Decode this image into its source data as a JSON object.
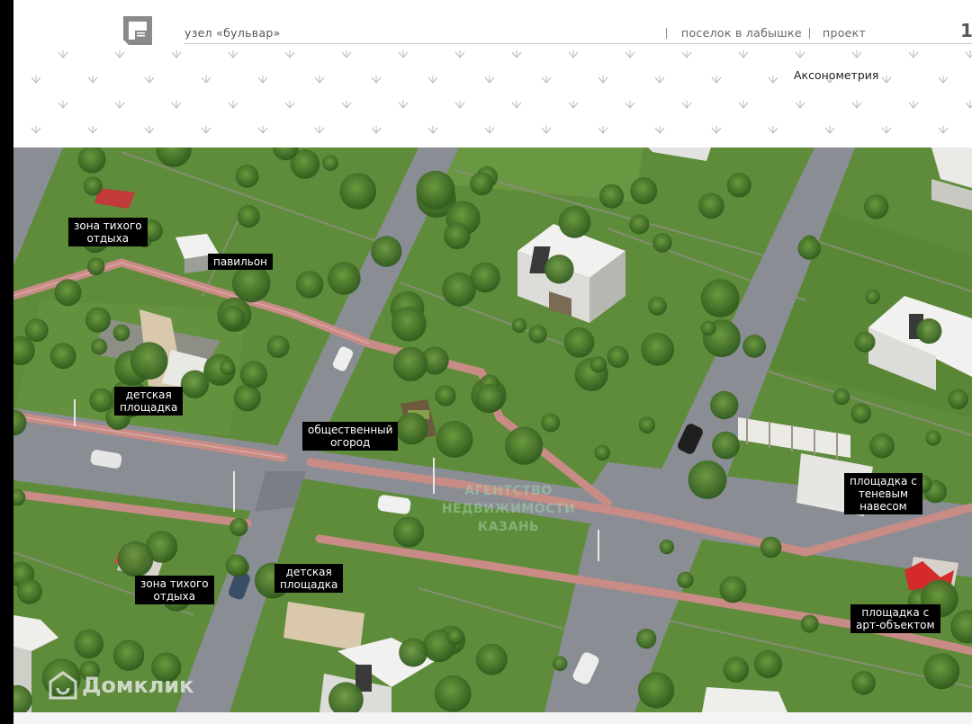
{
  "header": {
    "node_title": "узел «бульвар»",
    "crumbs": [
      "поселок в лабышке",
      "проект"
    ],
    "page_number": "1",
    "view_title": "Аксонометрия",
    "logo_icon": "building-logo-icon"
  },
  "map": {
    "labels": {
      "quiet_zone_top": "зона тихого\nотдыха",
      "pavilion": "павильон",
      "playground_left": "детская\nплощадка",
      "community_garden": "общественный\nогород",
      "shade_area": "площадка с\nтеневым\nнавесом",
      "quiet_zone_bottom": "зона тихого\nотдыха",
      "playground_bottom": "детская\nплощадка",
      "art_area": "площадка с\nарт-объектом"
    },
    "watermark": "АГЕНТСТВО\nНЕДВИЖИМОСТИ\nКАЗАНЬ",
    "brand": "Домклик",
    "colors": {
      "grass": "#5e8a3a",
      "road": "#8a8e94",
      "path": "#c98b86",
      "label_bg": "#000000"
    }
  }
}
